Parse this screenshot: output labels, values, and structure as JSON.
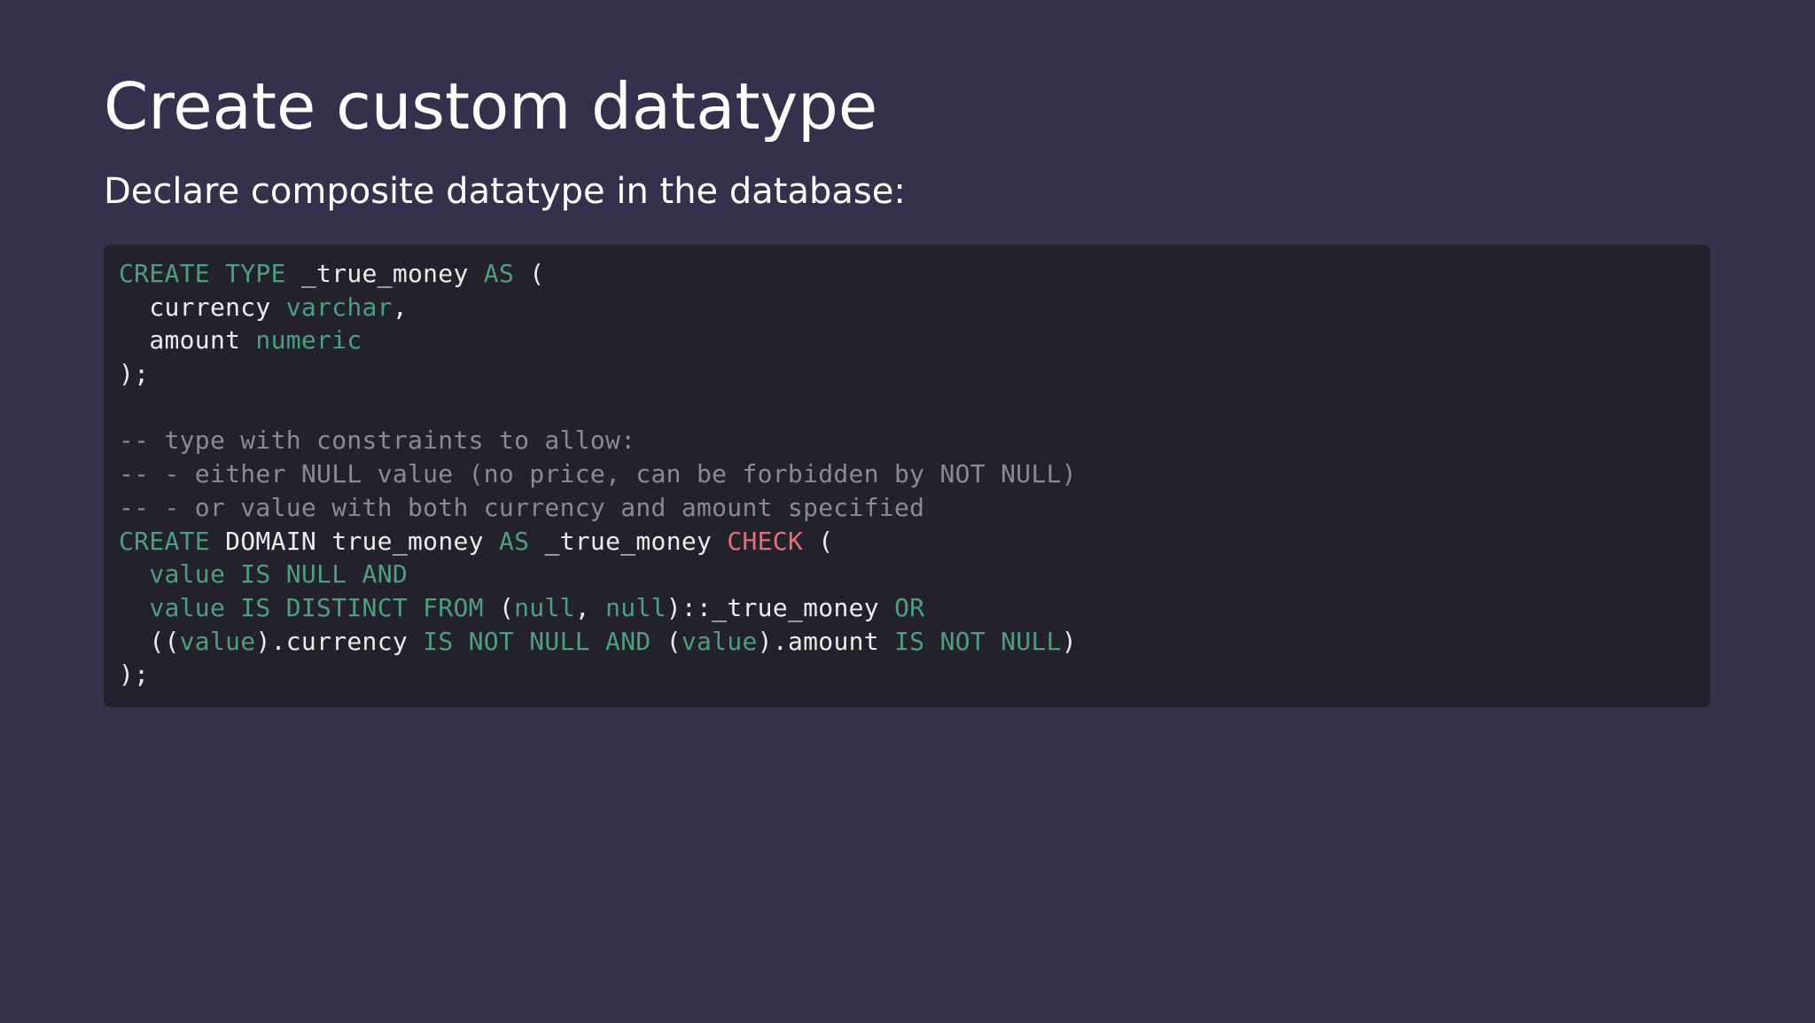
{
  "slide": {
    "title": "Create custom datatype",
    "subtitle": "Declare composite datatype in the database:"
  },
  "code": {
    "colors": {
      "background": "#23222c",
      "plain": "#ececec",
      "keyword": "#4e9e80",
      "comment": "#8a8a95",
      "check": "#e0707a"
    },
    "lines": [
      [
        {
          "t": "CREATE TYPE",
          "k": "keyword"
        },
        {
          "t": " _true_money ",
          "k": "plain"
        },
        {
          "t": "AS",
          "k": "keyword"
        },
        {
          "t": " (",
          "k": "plain"
        }
      ],
      [
        {
          "t": "  currency ",
          "k": "plain"
        },
        {
          "t": "varchar",
          "k": "keyword"
        },
        {
          "t": ",",
          "k": "plain"
        }
      ],
      [
        {
          "t": "  amount ",
          "k": "plain"
        },
        {
          "t": "numeric",
          "k": "keyword"
        }
      ],
      [
        {
          "t": ");",
          "k": "plain"
        }
      ],
      [],
      [
        {
          "t": "-- type with constraints to allow:",
          "k": "comment"
        }
      ],
      [
        {
          "t": "-- - either NULL value (no price, can be forbidden by NOT NULL)",
          "k": "comment"
        }
      ],
      [
        {
          "t": "-- - or value with both currency and amount specified",
          "k": "comment"
        }
      ],
      [
        {
          "t": "CREATE",
          "k": "keyword"
        },
        {
          "t": " DOMAIN true_money ",
          "k": "plain"
        },
        {
          "t": "AS",
          "k": "keyword"
        },
        {
          "t": " _true_money ",
          "k": "plain"
        },
        {
          "t": "CHECK",
          "k": "check"
        },
        {
          "t": " (",
          "k": "plain"
        }
      ],
      [
        {
          "t": "  ",
          "k": "plain"
        },
        {
          "t": "value IS NULL AND",
          "k": "keyword"
        }
      ],
      [
        {
          "t": "  ",
          "k": "plain"
        },
        {
          "t": "value IS DISTINCT FROM",
          "k": "keyword"
        },
        {
          "t": " (",
          "k": "plain"
        },
        {
          "t": "null",
          "k": "keyword"
        },
        {
          "t": ", ",
          "k": "plain"
        },
        {
          "t": "null",
          "k": "keyword"
        },
        {
          "t": ")::_true_money ",
          "k": "plain"
        },
        {
          "t": "OR",
          "k": "keyword"
        }
      ],
      [
        {
          "t": "  ((",
          "k": "plain"
        },
        {
          "t": "value",
          "k": "keyword"
        },
        {
          "t": ").currency ",
          "k": "plain"
        },
        {
          "t": "IS NOT NULL AND",
          "k": "keyword"
        },
        {
          "t": " (",
          "k": "plain"
        },
        {
          "t": "value",
          "k": "keyword"
        },
        {
          "t": ").amount ",
          "k": "plain"
        },
        {
          "t": "IS NOT NULL",
          "k": "keyword"
        },
        {
          "t": ")",
          "k": "plain"
        }
      ],
      [
        {
          "t": ");",
          "k": "plain"
        }
      ]
    ]
  }
}
